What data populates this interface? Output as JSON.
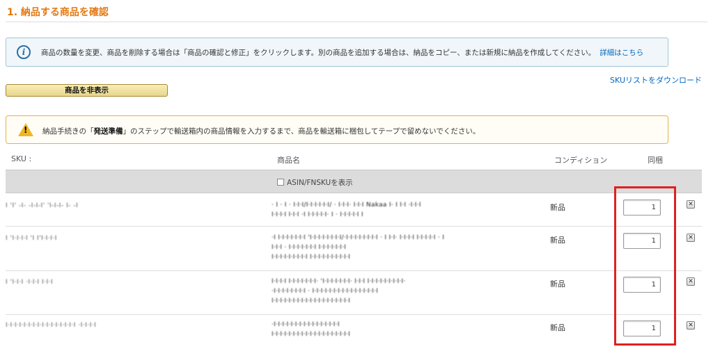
{
  "page": {
    "title": "1. 納品する商品を確認"
  },
  "info": {
    "text": "商品の数量を変更、商品を削除する場合は「商品の確認と修正」をクリックします。別の商品を追加する場合は、納品をコピー、または新規に納品を作成してください。",
    "link": "詳細はこちら"
  },
  "sku_download": "SKUリストをダウンロード",
  "hide_button": "商品を非表示",
  "warning": {
    "pre": "納品手続きの「",
    "bold": "発送準備",
    "post": "」のステップで輸送箱内の商品情報を入力するまで、商品を輸送箱に梱包してテープで留めないでください。"
  },
  "table": {
    "headers": {
      "sku": "SKU :",
      "name": "商品名",
      "condition": "コンディション",
      "qty": "同梱"
    },
    "asin_toggle": "ASIN/FNSKUを表示",
    "rows": [
      {
        "sku": "I 'I' -I- -I-I-I' 'I-I-I- I- -I",
        "name_lines": [
          "· I · I · I·I·I/I·I·I·I·I·I/ · I·I·I· I·I·I Nakaa I· I I·I ·I·I·I",
          "I·I·I·I I·I·I ·I I·I·I·I·I· I · I·I·I·I·I I"
        ],
        "condition": "新品",
        "qty": "1"
      },
      {
        "sku": "I 'I·I·I·I 'I I'I·I·I·I",
        "name_lines": [
          "·I I·I·I·I·I·I·I 'I·I·I·I·I·I·I·I/·I·I·I·I·I·I·I·I · I I·I· I·I·I·I I·I·I·I·I · I",
          "I·I·I · I·I·I·I·I·I·I I·I·I·I·I·I·I",
          "I·I·I·I·I·I·I·I·I I·I·I·I·I·I·I·I·I·I"
        ],
        "condition": "新品",
        "qty": "1"
      },
      {
        "sku": "I 'I·I·I ·I·I·I I·I·I",
        "name_lines": [
          "I·I·I·I I·I·I·I·I·I·I· 'I·I·I·I·I·I·I· I·I·I I·I·I·I·I·I·I·I·I·",
          "·I·I·I·I·I·I·I·I · I·I·I·I·I·I·I·I·I·I·I·I·I·I·I·I",
          "I·I·I·I·I·I·I·I·I·I·I·I·I·I·I·I·I·I·I"
        ],
        "condition": "新品",
        "qty": "1"
      },
      {
        "sku": "I·I·I·I·I·I·I·I·I·I·I·I·I·I·I·I ·I·I·I·I",
        "name_lines": [
          "·I·I·I·I·I·I·I·I·I·I·I·I·I·I·I·I",
          "I·I·I·I·I·I·I·I·I·I·I·I·I·I·I·I·I·I·I"
        ],
        "condition": "新品",
        "qty": "1"
      }
    ]
  },
  "colors": {
    "title": "#e47911",
    "link": "#0066c0",
    "highlight": "#e02020"
  }
}
